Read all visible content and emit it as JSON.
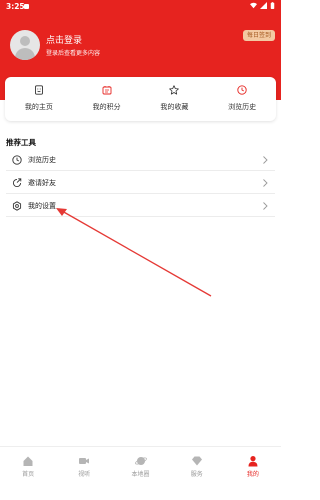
{
  "status_bar": {
    "time": "3:25"
  },
  "profile": {
    "title": "点击登录",
    "subtitle": "登录后查看更多内容",
    "badge": "每日签到"
  },
  "quick_links": [
    {
      "label": "我的主页",
      "icon": "profile-page-icon"
    },
    {
      "label": "我的积分",
      "icon": "points-icon"
    },
    {
      "label": "我的收藏",
      "icon": "star-icon"
    },
    {
      "label": "浏览历史",
      "icon": "clock-icon"
    }
  ],
  "tools": {
    "title": "推荐工具",
    "items": [
      {
        "label": "浏览历史",
        "icon": "clock-icon"
      },
      {
        "label": "邀请好友",
        "icon": "share-icon"
      },
      {
        "label": "我的设置",
        "icon": "settings-icon"
      }
    ]
  },
  "bottom_nav": [
    {
      "label": "首页",
      "icon": "home-icon",
      "active": false
    },
    {
      "label": "视听",
      "icon": "video-icon",
      "active": false
    },
    {
      "label": "本地圈",
      "icon": "planet-icon",
      "active": false
    },
    {
      "label": "服务",
      "icon": "diamond-icon",
      "active": false
    },
    {
      "label": "我的",
      "icon": "user-icon",
      "active": true
    }
  ],
  "colors": {
    "brand_red": "#e6231f",
    "arrow": "#e53935",
    "badge_bg": "#f3c9a2",
    "inactive": "#999999"
  }
}
